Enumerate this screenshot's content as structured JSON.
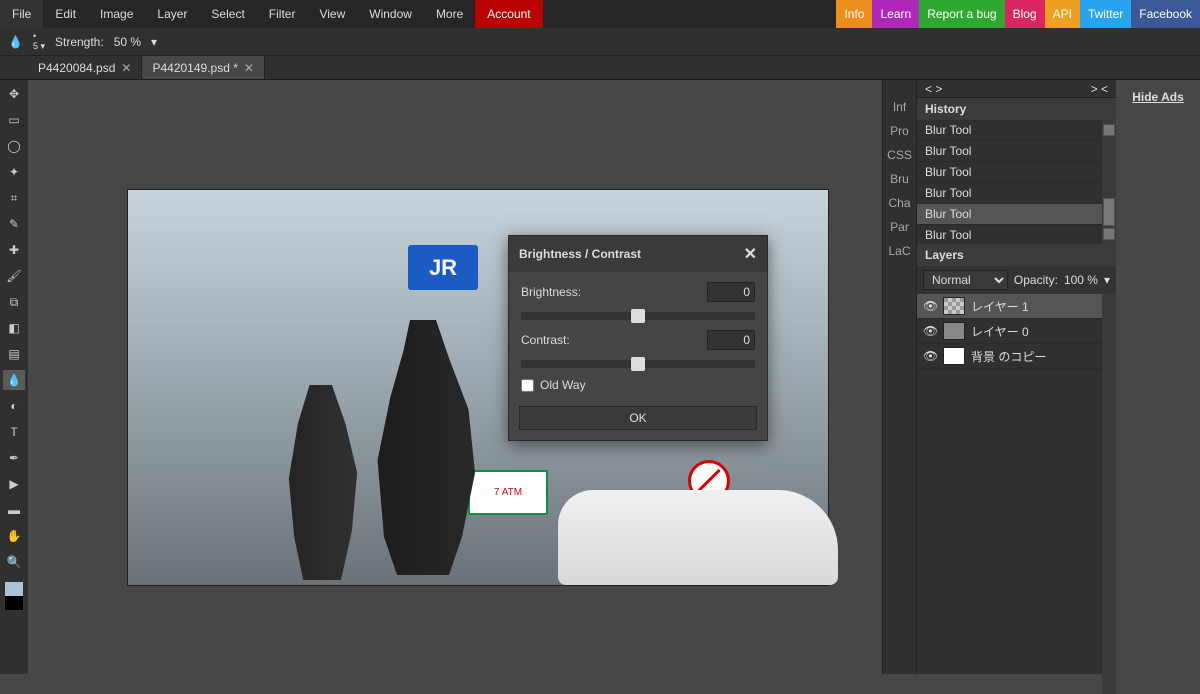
{
  "menu": {
    "items": [
      "File",
      "Edit",
      "Image",
      "Layer",
      "Select",
      "Filter",
      "View",
      "Window",
      "More"
    ],
    "account": "Account"
  },
  "ext_links": [
    {
      "label": "Info",
      "bg": "#ec8d1c"
    },
    {
      "label": "Learn",
      "bg": "#b028b8"
    },
    {
      "label": "Report a bug",
      "bg": "#2fa82f"
    },
    {
      "label": "Blog",
      "bg": "#d92662"
    },
    {
      "label": "API",
      "bg": "#f0a020"
    },
    {
      "label": "Twitter",
      "bg": "#2aa3ef"
    },
    {
      "label": "Facebook",
      "bg": "#3b5998"
    }
  ],
  "options": {
    "strength_label": "Strength:",
    "strength_value": "50 %"
  },
  "tabs": [
    {
      "label": "P4420084.psd",
      "active": false
    },
    {
      "label": "P4420149.psd *",
      "active": true
    }
  ],
  "tools": [
    "move",
    "rect-select",
    "lasso",
    "wand",
    "crop",
    "eyedrop",
    "heal",
    "brush",
    "clone",
    "eraser",
    "gradient",
    "blur",
    "dodge",
    "type",
    "pen",
    "path-sel",
    "shape",
    "hand",
    "zoom"
  ],
  "dialog": {
    "title": "Brightness / Contrast",
    "brightness_label": "Brightness:",
    "brightness_value": "0",
    "contrast_label": "Contrast:",
    "contrast_value": "0",
    "oldway_label": "Old Way",
    "ok": "OK"
  },
  "mid_tabs": [
    "Inf",
    "Pro",
    "CSS",
    "Bru",
    "Cha",
    "Par",
    "LaC"
  ],
  "arrows": {
    "left": "< >",
    "right": "> <"
  },
  "history": {
    "title": "History",
    "items": [
      "Blur Tool",
      "Blur Tool",
      "Blur Tool",
      "Blur Tool",
      "Blur Tool",
      "Blur Tool"
    ],
    "selected": 4
  },
  "layers": {
    "title": "Layers",
    "blend": "Normal",
    "opacity_label": "Opacity:",
    "opacity_value": "100 %",
    "items": [
      {
        "name": "レイヤー 1",
        "thumb": "chk",
        "sel": true
      },
      {
        "name": "レイヤー 0",
        "thumb": "img",
        "sel": false
      },
      {
        "name": "背景 のコピー",
        "thumb": "wht",
        "sel": false
      }
    ]
  },
  "ads": {
    "label": "Hide Ads"
  },
  "canvas": {
    "jr": "JR",
    "arrow": "←",
    "seven": "7 ATM"
  }
}
